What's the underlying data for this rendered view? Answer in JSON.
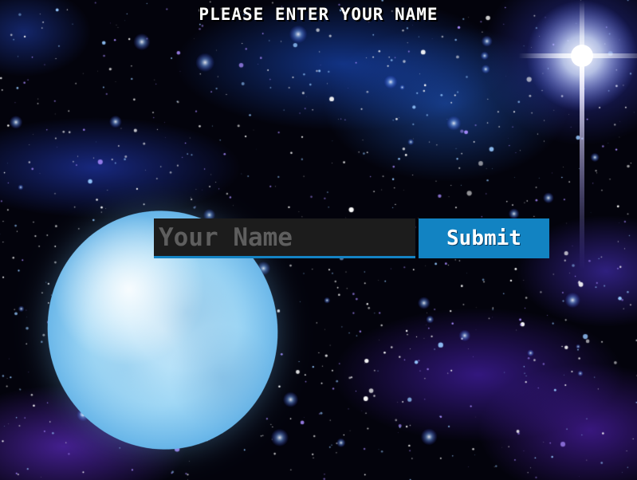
{
  "title": "PLEASE ENTER YOUR NAME",
  "form": {
    "name_placeholder": "Your Name",
    "name_value": "",
    "submit_label": "Submit"
  },
  "colors": {
    "accent": "#1283c2",
    "input_background": "#1c1c1c",
    "placeholder_text": "#5e5e5e",
    "title_text": "#ffffff"
  },
  "background": {
    "scene": "space-starfield",
    "elements": [
      "moon",
      "starburst",
      "galaxy-clouds"
    ]
  }
}
